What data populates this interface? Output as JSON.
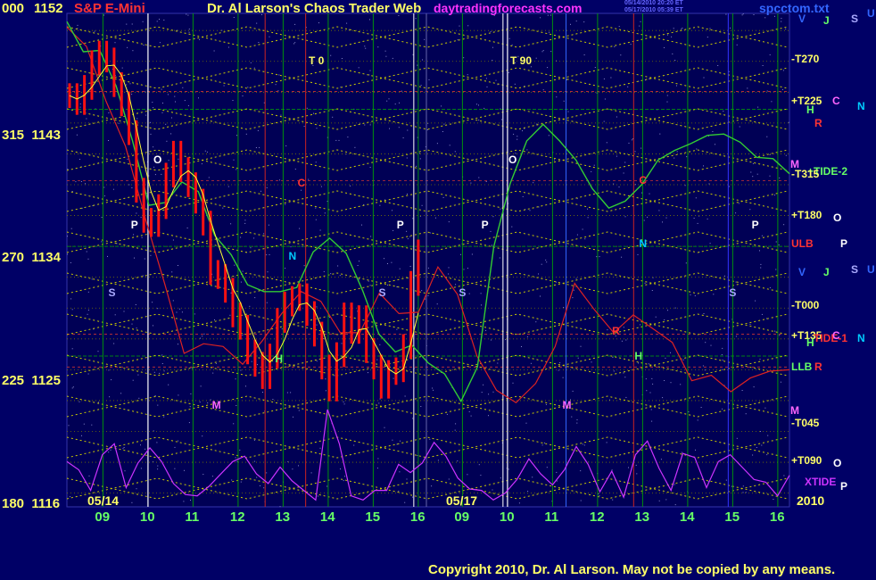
{
  "header": {
    "left_number": "000",
    "left_price": "1152",
    "symbol": "S&P E-Mini",
    "title": "Dr. Al Larson's Chaos Trader Web",
    "site": "daytradingforecasts.com",
    "stamp1": "05/14/2010 20:20 ET",
    "stamp2": "05/17/2010 05:39 ET",
    "file": "spcctom.txt",
    "letters": [
      "V",
      "J",
      "S",
      "U"
    ]
  },
  "footer": {
    "copyright": "Copyright 2010, Dr. Al Larson. May not be copied by any means.",
    "year": "2010"
  },
  "colors": {
    "background": "#000066",
    "grid_yellow": "#ffff66",
    "grid_green": "#00cc00",
    "bars": "#ff0000",
    "xtide": "#cc33ff"
  },
  "chart_data": {
    "type": "line",
    "title": "S&P E-Mini",
    "y_axis": {
      "ticks": [
        {
          "angle": "000",
          "price": "1152"
        },
        {
          "angle": "315",
          "price": "1143"
        },
        {
          "angle": "270",
          "price": "1134"
        },
        {
          "angle": "225",
          "price": "1125"
        },
        {
          "angle": "180",
          "price": "1116"
        }
      ],
      "ylim": [
        1116,
        1152
      ]
    },
    "x_axis": {
      "ticks": [
        "09",
        "10",
        "11",
        "12",
        "13",
        "14",
        "15",
        "16",
        "09",
        "10",
        "11",
        "12",
        "13",
        "14",
        "15",
        "16"
      ],
      "dates": [
        "05/14",
        "05/17"
      ]
    },
    "markers": [
      "T 0",
      "T 90"
    ],
    "right_labels": [
      {
        "text": "-T270",
        "value": 1148.7,
        "color": "#ffff66"
      },
      {
        "text": "+T225",
        "value": 1145.6,
        "color": "#ffff66"
      },
      {
        "text": "C",
        "value": 1145.6,
        "color": "#ff66ff"
      },
      {
        "text": "N",
        "value": 1145.2,
        "color": "#00ccff"
      },
      {
        "text": "H",
        "value": 1145.0,
        "color": "#66ff66"
      },
      {
        "text": "R",
        "value": 1144.0,
        "color": "#ff3333"
      },
      {
        "text": "M",
        "value": 1141.0,
        "color": "#ff66ff"
      },
      {
        "text": "+TIDE-2",
        "value": 1140.5,
        "color": "#66ff66"
      },
      {
        "text": "-T315",
        "value": 1140.3,
        "color": "#ffff66"
      },
      {
        "text": "+T180",
        "value": 1137.3,
        "color": "#ffff66"
      },
      {
        "text": "O",
        "value": 1137.1,
        "color": "#ffffff"
      },
      {
        "text": "ULB",
        "value": 1135.2,
        "color": "#ff3333"
      },
      {
        "text": "P",
        "value": 1135.2,
        "color": "#ffffff"
      },
      {
        "text": "V",
        "value": 1133.1,
        "color": "#3366ff"
      },
      {
        "text": "J",
        "value": 1133.1,
        "color": "#66ff66"
      },
      {
        "text": "S",
        "value": 1133.3,
        "color": "#aaaaff"
      },
      {
        "text": "U",
        "value": 1133.3,
        "color": "#3366ff"
      },
      {
        "text": "-T000",
        "value": 1130.7,
        "color": "#ffff66"
      },
      {
        "text": "+T135",
        "value": 1128.5,
        "color": "#ffff66"
      },
      {
        "text": "TIDE-1",
        "value": 1128.3,
        "color": "#ff3333"
      },
      {
        "text": "C",
        "value": 1128.5,
        "color": "#ff66ff"
      },
      {
        "text": "N",
        "value": 1128.3,
        "color": "#00ccff"
      },
      {
        "text": "H",
        "value": 1128.0,
        "color": "#66ff66"
      },
      {
        "text": "LLB",
        "value": 1126.2,
        "color": "#66ff66"
      },
      {
        "text": "R",
        "value": 1126.2,
        "color": "#ff3333"
      },
      {
        "text": "M",
        "value": 1123.0,
        "color": "#ff66ff"
      },
      {
        "text": "-T045",
        "value": 1122.1,
        "color": "#ffff66"
      },
      {
        "text": "+T090",
        "value": 1119.4,
        "color": "#ffff66"
      },
      {
        "text": "O",
        "value": 1119.2,
        "color": "#ffffff"
      },
      {
        "text": "XTIDE",
        "value": 1117.8,
        "color": "#cc33ff"
      },
      {
        "text": "P",
        "value": 1117.5,
        "color": "#ffffff"
      }
    ],
    "chart_labels": [
      {
        "text": "O",
        "color": "#ffffff",
        "day": 1,
        "time": 10.2,
        "value": 1141.3
      },
      {
        "text": "P",
        "color": "#ffffff",
        "day": 1,
        "time": 9.7,
        "value": 1136.6
      },
      {
        "text": "P",
        "color": "#ffffff",
        "day": 1,
        "time": 15.6,
        "value": 1136.6
      },
      {
        "text": "S",
        "color": "#aaaaff",
        "day": 1,
        "time": 9.2,
        "value": 1131.6
      },
      {
        "text": "S",
        "color": "#aaaaff",
        "day": 1,
        "time": 15.2,
        "value": 1131.6
      },
      {
        "text": "N",
        "color": "#00ccff",
        "day": 1,
        "time": 13.2,
        "value": 1134.3
      },
      {
        "text": "C",
        "color": "#ff3333",
        "day": 1,
        "time": 13.4,
        "value": 1139.6
      },
      {
        "text": "H",
        "color": "#66ff66",
        "day": 1,
        "time": 12.9,
        "value": 1126.8
      },
      {
        "text": "M",
        "color": "#ff66ff",
        "day": 1,
        "time": 11.5,
        "value": 1123.4
      },
      {
        "text": "O",
        "color": "#ffffff",
        "day": 2,
        "time": 10.1,
        "value": 1141.3
      },
      {
        "text": "P",
        "color": "#ffffff",
        "day": 2,
        "time": 9.5,
        "value": 1136.6
      },
      {
        "text": "P",
        "color": "#ffffff",
        "day": 2,
        "time": 15.5,
        "value": 1136.6
      },
      {
        "text": "S",
        "color": "#aaaaff",
        "day": 2,
        "time": 9.0,
        "value": 1131.6
      },
      {
        "text": "S",
        "color": "#aaaaff",
        "day": 2,
        "time": 15.0,
        "value": 1131.6
      },
      {
        "text": "N",
        "color": "#00ccff",
        "day": 2,
        "time": 13.0,
        "value": 1135.2
      },
      {
        "text": "C",
        "color": "#ff3333",
        "day": 2,
        "time": 13.0,
        "value": 1139.8
      },
      {
        "text": "R",
        "color": "#ff3333",
        "day": 2,
        "time": 12.4,
        "value": 1128.8
      },
      {
        "text": "H",
        "color": "#66ff66",
        "day": 2,
        "time": 12.9,
        "value": 1127.0
      },
      {
        "text": "M",
        "color": "#ff66ff",
        "day": 2,
        "time": 11.3,
        "value": 1123.4
      }
    ],
    "series": [
      {
        "type": "bar",
        "values": [
          1146.0,
          1145.5,
          1146.6,
          1148.4,
          1149.1,
          1148.6,
          1146.8,
          1145.4,
          1143.3,
          1139.1,
          1136.9,
          1136.6,
          1137.9,
          1140.2,
          1141.8,
          1140.6,
          1139.5,
          1138.3,
          1136.7,
          1133.1,
          1132.8,
          1131.8,
          1130.0,
          1129.1,
          1127.3,
          1126.4,
          1125.5,
          1127.0,
          1129.6,
          1130.8,
          1131.2,
          1131.4,
          1130.1,
          1128.6,
          1126.2,
          1124.6,
          1127.1,
          1130.0,
          1128.8,
          1129.8,
          1127.4,
          1126.2,
          1124.8,
          1125.8,
          1126.0,
          1127.7,
          1132.3,
          1134.6
        ]
      },
      {
        "type": "line",
        "name": "green",
        "values": [
          1151.4,
          1149.2,
          1149.3,
          1146.7,
          1142.7,
          1138.0,
          1138.2,
          1139.7,
          1139.0,
          1135.8,
          1134.4,
          1132.2,
          1131.7,
          1131.7,
          1132.0,
          1134.6,
          1135.6,
          1134.5,
          1131.8,
          1128.6,
          1127.3,
          1127.8,
          1126.5,
          1125.7,
          1123.7,
          1126.2,
          1135.0,
          1139.6,
          1142.7,
          1143.9,
          1142.7,
          1141.3,
          1139.2,
          1137.8,
          1138.3,
          1139.5,
          1141.3,
          1142.0,
          1142.5,
          1143.1,
          1143.2,
          1142.6,
          1141.5,
          1141.4,
          1140.3
        ]
      },
      {
        "type": "line",
        "name": "red",
        "values": [
          1151.0,
          1149.6,
          1145.6,
          1142.3,
          1137.1,
          1132.3,
          1127.2,
          1127.9,
          1127.7,
          1126.4,
          1128.1,
          1130.1,
          1131.7,
          1131.0,
          1128.7,
          1128.7,
          1131.6,
          1130.1,
          1130.2,
          1133.5,
          1131.5,
          1127.0,
          1124.5,
          1123.6,
          1125.0,
          1127.7,
          1132.3,
          1130.4,
          1128.7,
          1130.0,
          1129.0,
          1128.0,
          1125.2,
          1125.6,
          1124.4,
          1125.4,
          1125.9,
          1126.0
        ]
      },
      {
        "type": "line",
        "name": "XTIDE",
        "values": [
          1119.3,
          1118.7,
          1117.2,
          1119.8,
          1120.6,
          1117.4,
          1119.2,
          1120.3,
          1119.3,
          1117.7,
          1116.9,
          1116.8,
          1117.5,
          1118.4,
          1119.3,
          1119.7,
          1118.4,
          1117.7,
          1118.9,
          1117.9,
          1117.2,
          1116.5,
          1123.1,
          1120.6,
          1116.8,
          1116.5,
          1117.2,
          1117.2,
          1119.1,
          1118.5,
          1119.2,
          1120.7,
          1119.7,
          1118.1,
          1117.3,
          1117.2,
          1116.5,
          1117.0,
          1118.0,
          1119.5,
          1118.4,
          1117.6,
          1118.7,
          1120.4,
          1119.1,
          1117.1,
          1118.6,
          1116.7,
          1119.8,
          1120.8,
          1118.8,
          1117.2,
          1119.9,
          1119.6,
          1117.4,
          1119.3,
          1119.8,
          1118.9,
          1118.0,
          1117.8,
          1116.8,
          1118.3
        ]
      }
    ]
  }
}
